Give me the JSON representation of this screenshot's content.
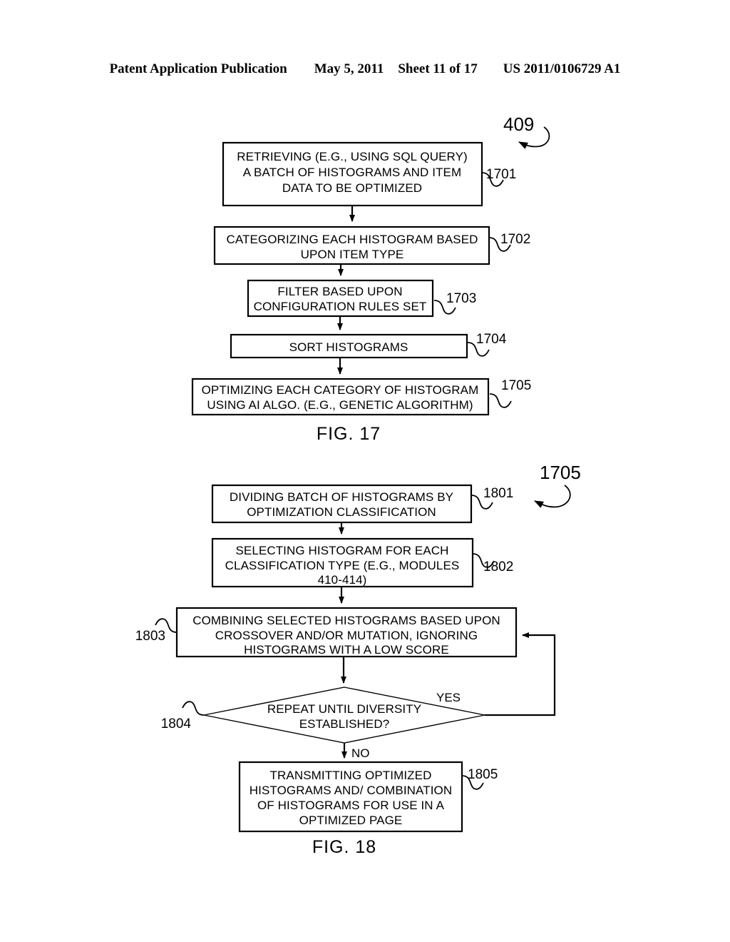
{
  "header": {
    "publication": "Patent Application Publication",
    "date": "May 5, 2011",
    "sheet": "Sheet 11 of 17",
    "patent_number": "US 2011/0106729 A1"
  },
  "figures": [
    {
      "id": "fig17",
      "caption": "FIG.  17",
      "top_reference": "409",
      "nodes": [
        {
          "ref": "1701",
          "shape": "process",
          "lines": [
            "RETRIEVING (E.G., USING SQL QUERY)",
            "A BATCH OF HISTOGRAMS AND ITEM",
            "DATA TO BE OPTIMIZED"
          ]
        },
        {
          "ref": "1702",
          "shape": "process",
          "lines": [
            "CATEGORIZING EACH HISTOGRAM BASED",
            "UPON ITEM TYPE"
          ]
        },
        {
          "ref": "1703",
          "shape": "process",
          "lines": [
            "FILTER BASED UPON",
            "CONFIGURATION RULES SET"
          ]
        },
        {
          "ref": "1704",
          "shape": "process",
          "lines": [
            "SORT HISTOGRAMS"
          ]
        },
        {
          "ref": "1705",
          "shape": "process",
          "lines": [
            "OPTIMIZING EACH CATEGORY OF HISTOGRAM",
            "USING AI ALGO. (E.G., GENETIC ALGORITHM)"
          ]
        }
      ]
    },
    {
      "id": "fig18",
      "caption": "FIG.  18",
      "top_reference": "1705",
      "nodes": [
        {
          "ref": "1801",
          "shape": "process",
          "lines": [
            "DIVIDING BATCH OF HISTOGRAMS BY",
            "OPTIMIZATION CLASSIFICATION"
          ]
        },
        {
          "ref": "1802",
          "shape": "process",
          "lines": [
            "SELECTING  HISTOGRAM FOR EACH",
            "CLASSIFICATION TYPE (E.G., MODULES",
            "410-414)"
          ]
        },
        {
          "ref": "1803",
          "shape": "process",
          "lines": [
            "COMBINING SELECTED HISTOGRAMS BASED UPON",
            "CROSSOVER AND/OR MUTATION, IGNORING",
            "HISTOGRAMS WITH A LOW SCORE"
          ]
        },
        {
          "ref": "1804",
          "shape": "decision",
          "lines": [
            "REPEAT UNTIL DIVERSITY",
            "ESTABLISHED?"
          ],
          "branch_yes": "YES",
          "branch_no": "NO"
        },
        {
          "ref": "1805",
          "shape": "process",
          "lines": [
            "TRANSMITTING OPTIMIZED",
            "HISTOGRAMS AND/ COMBINATION",
            "OF HISTOGRAMS FOR USE IN A",
            "OPTIMIZED PAGE"
          ]
        }
      ]
    }
  ],
  "colors": {
    "ink": "#000000",
    "paper": "#ffffff"
  }
}
